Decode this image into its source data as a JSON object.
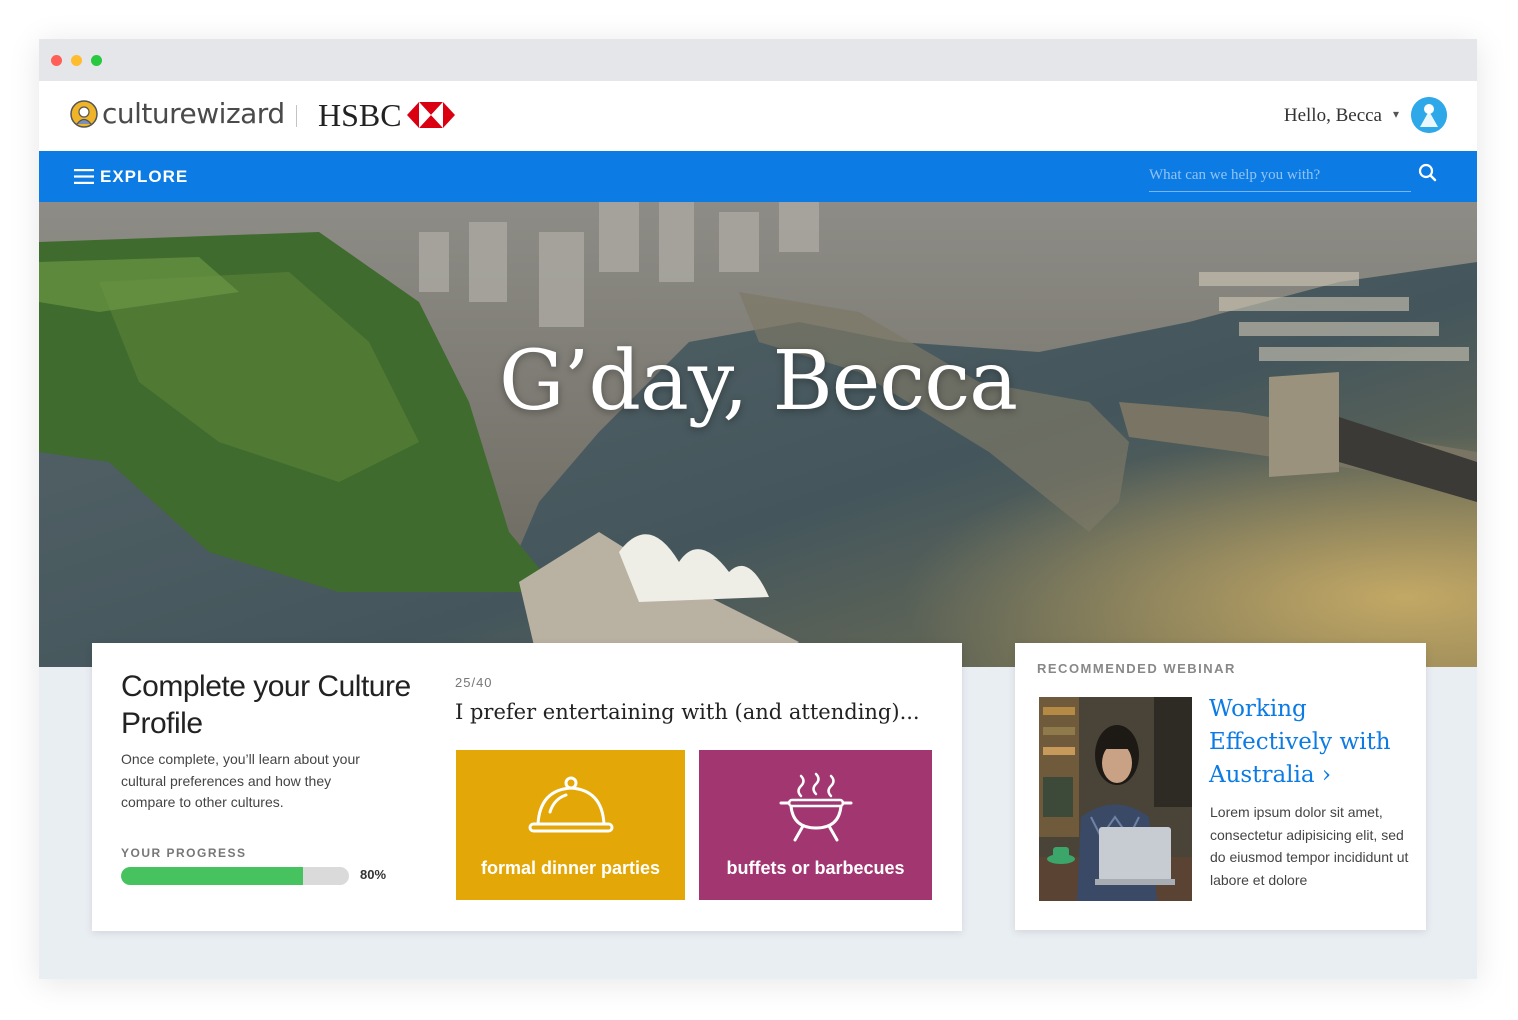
{
  "header": {
    "brand": "culturewizard",
    "partner": "HSBC",
    "greeting": "Hello, Becca"
  },
  "nav": {
    "explore_label": "EXPLORE",
    "search_placeholder": "What can we help you with?"
  },
  "hero": {
    "title": "G’day, Becca"
  },
  "profile": {
    "title": "Complete your Culture Profile",
    "description": "Once complete, you’ll learn about your cultural preferences and how they compare to other cultures.",
    "progress_label": "YOUR PROGRESS",
    "progress_value": 80,
    "progress_text": "80%",
    "question_count": "25/40",
    "question": "I prefer entertaining with (and attending)...",
    "options": [
      {
        "label": "formal dinner parties",
        "icon": "cloche-icon",
        "color": "#e3a707"
      },
      {
        "label": "buffets or barbecues",
        "icon": "barbecue-icon",
        "color": "#a23670"
      }
    ]
  },
  "webinar": {
    "label": "RECOMMENDED WEBINAR",
    "title": "Working Effectively with Australia ›",
    "description": "Lorem ipsum dolor sit amet, consectetur adipisicing elit, sed do eiusmod tempor incididunt ut labore et dolore"
  },
  "colors": {
    "nav_blue": "#0c7be4",
    "progress_green": "#46c35f",
    "option_gold": "#e3a707",
    "option_plum": "#a23670"
  }
}
